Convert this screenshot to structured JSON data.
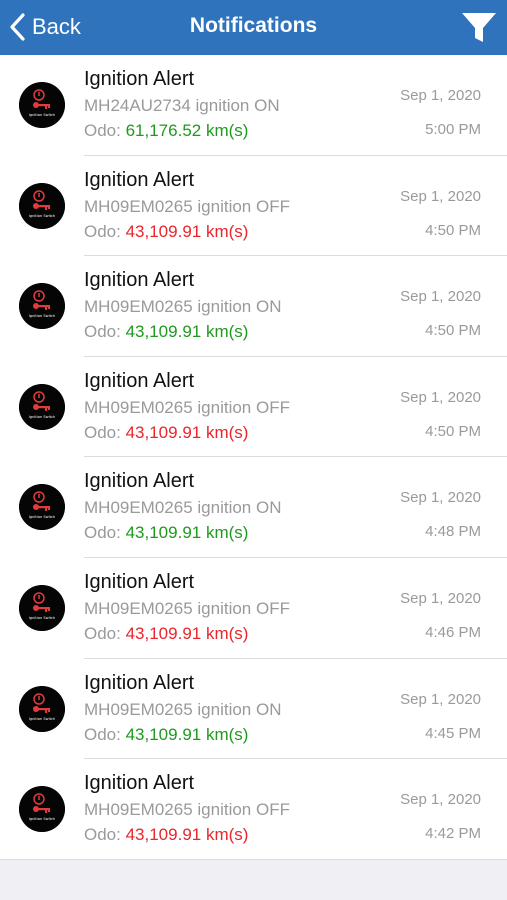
{
  "header": {
    "back_label": "Back",
    "title": "Notifications",
    "back_icon": "chevron-left-icon",
    "filter_icon": "filter-icon"
  },
  "colors": {
    "navbar": "#2f73bd",
    "odo_on": "#1f9a1f",
    "odo_off": "#e8262b"
  },
  "notifications": [
    {
      "title": "Ignition Alert",
      "message": "MH24AU2734 ignition ON",
      "odo_label": "Odo:",
      "odo_value": "61,176.52 km(s)",
      "state": "on",
      "date": "Sep 1, 2020",
      "time": "5:00 PM",
      "icon_label": "Ignition Switch"
    },
    {
      "title": "Ignition Alert",
      "message": "MH09EM0265 ignition OFF",
      "odo_label": "Odo:",
      "odo_value": "43,109.91 km(s)",
      "state": "off",
      "date": "Sep 1, 2020",
      "time": "4:50 PM",
      "icon_label": "Ignition Switch"
    },
    {
      "title": "Ignition Alert",
      "message": "MH09EM0265 ignition ON",
      "odo_label": "Odo:",
      "odo_value": "43,109.91 km(s)",
      "state": "on",
      "date": "Sep 1, 2020",
      "time": "4:50 PM",
      "icon_label": "Ignition Switch"
    },
    {
      "title": "Ignition Alert",
      "message": "MH09EM0265 ignition OFF",
      "odo_label": "Odo:",
      "odo_value": "43,109.91 km(s)",
      "state": "off",
      "date": "Sep 1, 2020",
      "time": "4:50 PM",
      "icon_label": "Ignition Switch"
    },
    {
      "title": "Ignition Alert",
      "message": "MH09EM0265 ignition ON",
      "odo_label": "Odo:",
      "odo_value": "43,109.91 km(s)",
      "state": "on",
      "date": "Sep 1, 2020",
      "time": "4:48 PM",
      "icon_label": "Ignition Switch"
    },
    {
      "title": "Ignition Alert",
      "message": "MH09EM0265 ignition OFF",
      "odo_label": "Odo:",
      "odo_value": "43,109.91 km(s)",
      "state": "off",
      "date": "Sep 1, 2020",
      "time": "4:46 PM",
      "icon_label": "Ignition Switch"
    },
    {
      "title": "Ignition Alert",
      "message": "MH09EM0265 ignition ON",
      "odo_label": "Odo:",
      "odo_value": "43,109.91 km(s)",
      "state": "on",
      "date": "Sep 1, 2020",
      "time": "4:45 PM",
      "icon_label": "Ignition Switch"
    },
    {
      "title": "Ignition Alert",
      "message": "MH09EM0265 ignition OFF",
      "odo_label": "Odo:",
      "odo_value": "43,109.91 km(s)",
      "state": "off",
      "date": "Sep 1, 2020",
      "time": "4:42 PM",
      "icon_label": "Ignition Switch"
    }
  ]
}
